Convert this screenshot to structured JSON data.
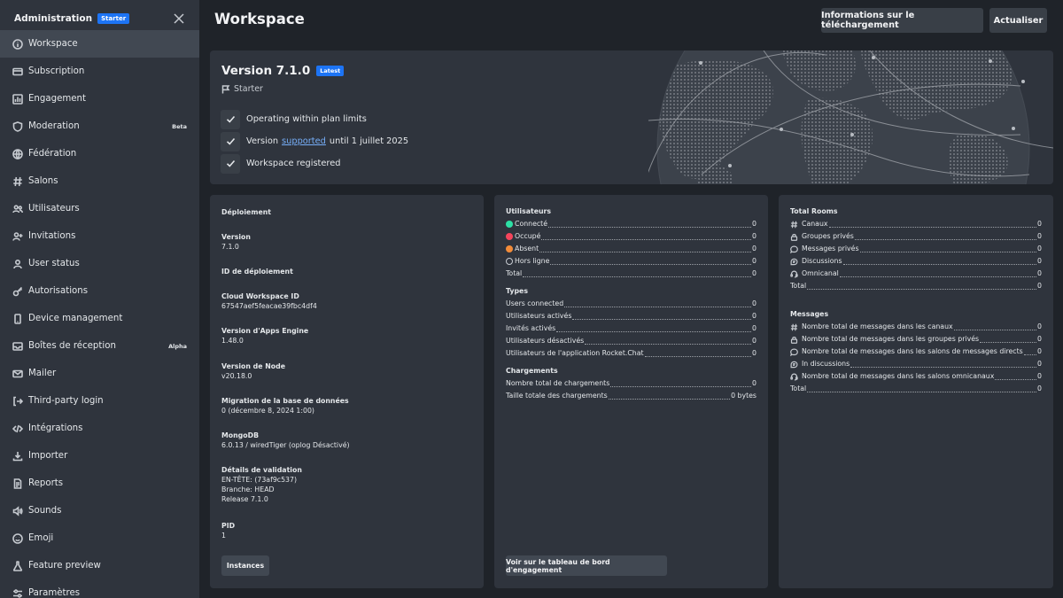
{
  "sidebar": {
    "title": "Administration",
    "badge": "Starter",
    "items": [
      {
        "label": "Workspace",
        "icon": "info-icon",
        "active": true
      },
      {
        "label": "Subscription",
        "icon": "card-icon"
      },
      {
        "label": "Engagement",
        "icon": "chart-icon"
      },
      {
        "label": "Moderation",
        "icon": "shield-icon",
        "tag": "Beta"
      },
      {
        "label": "Fédération",
        "icon": "globe-icon"
      },
      {
        "label": "Salons",
        "icon": "hashtag-icon"
      },
      {
        "label": "Utilisateurs",
        "icon": "team-icon"
      },
      {
        "label": "Invitations",
        "icon": "user-plus-icon"
      },
      {
        "label": "User status",
        "icon": "user-icon"
      },
      {
        "label": "Autorisations",
        "icon": "key-icon"
      },
      {
        "label": "Device management",
        "icon": "mobile-icon"
      },
      {
        "label": "Boîtes de réception",
        "icon": "mail-icon",
        "tag": "Alpha"
      },
      {
        "label": "Mailer",
        "icon": "envelope-icon"
      },
      {
        "label": "Third-party login",
        "icon": "login-icon"
      },
      {
        "label": "Intégrations",
        "icon": "code-icon"
      },
      {
        "label": "Importer",
        "icon": "import-icon"
      },
      {
        "label": "Reports",
        "icon": "document-icon"
      },
      {
        "label": "Sounds",
        "icon": "volume-icon"
      },
      {
        "label": "Emoji",
        "icon": "emoji-icon"
      },
      {
        "label": "Feature preview",
        "icon": "flask-icon"
      },
      {
        "label": "Paramètres",
        "icon": "settings-icon"
      }
    ]
  },
  "header": {
    "title": "Workspace",
    "download_info_label": "Informations sur le téléchargement",
    "refresh_label": "Actualiser"
  },
  "version_card": {
    "title": "Version 7.1.0",
    "badge": "Latest",
    "plan": "Starter",
    "checks": [
      {
        "text": "Operating within plan limits"
      },
      {
        "pre": "Version",
        "link": "supported",
        "post": "until 1 juillet 2025"
      },
      {
        "text": "Workspace registered"
      }
    ]
  },
  "deployment": {
    "heading": "Déploiement",
    "fields": [
      {
        "label": "Version",
        "value": "7.1.0"
      },
      {
        "label": "ID de déploiement",
        "value": ""
      },
      {
        "label": "Cloud Workspace ID",
        "value": "67547aef5feacae39fbc4df4"
      },
      {
        "label": "Version d'Apps Engine",
        "value": "1.48.0"
      },
      {
        "label": "Version de Node",
        "value": "v20.18.0"
      },
      {
        "label": "Migration de la base de données",
        "value": "0 (décembre 8, 2024 1:00)"
      },
      {
        "label": "MongoDB",
        "value": "6.0.13 / wiredTiger (oplog Désactivé)"
      },
      {
        "label": "Détails de validation",
        "value": "EN-TÊTE: (73af9c537)",
        "value2": "Branche: HEAD",
        "value3": "Release 7.1.0"
      },
      {
        "label": "PID",
        "value": "1"
      }
    ],
    "button": "Instances"
  },
  "users": {
    "heading": "Utilisateurs",
    "rows": [
      {
        "label": "Connecté",
        "value": "0",
        "status": "online"
      },
      {
        "label": "Occupé",
        "value": "0",
        "status": "busy"
      },
      {
        "label": "Absent",
        "value": "0",
        "status": "away"
      },
      {
        "label": "Hors ligne",
        "value": "0",
        "status": "offline"
      },
      {
        "label": "Total",
        "value": "0"
      }
    ],
    "types_heading": "Types",
    "types": [
      {
        "label": "Users connected",
        "value": "0"
      },
      {
        "label": "Utilisateurs activés",
        "value": "0"
      },
      {
        "label": "Invités activés",
        "value": "0"
      },
      {
        "label": "Utilisateurs désactivés",
        "value": "0"
      },
      {
        "label": "Utilisateurs de l'application Rocket.Chat",
        "value": "0"
      }
    ],
    "uploads_heading": "Chargements",
    "uploads": [
      {
        "label": "Nombre total de chargements",
        "value": "0"
      },
      {
        "label": "Taille totale des chargements",
        "value": "0 bytes"
      }
    ],
    "button": "Voir sur le tableau de bord d'engagement"
  },
  "rooms": {
    "heading": "Total Rooms",
    "rows": [
      {
        "label": "Canaux",
        "value": "0",
        "icon": "hashtag-icon"
      },
      {
        "label": "Groupes privés",
        "value": "0",
        "icon": "lock-icon"
      },
      {
        "label": "Messages privés",
        "value": "0",
        "icon": "chat-icon"
      },
      {
        "label": "Discussions",
        "value": "0",
        "icon": "discussion-icon"
      },
      {
        "label": "Omnicanal",
        "value": "0",
        "icon": "headset-icon"
      },
      {
        "label": "Total",
        "value": "0"
      }
    ],
    "messages_heading": "Messages",
    "messages": [
      {
        "label": "Nombre total de messages dans les canaux",
        "value": "0",
        "icon": "hashtag-icon"
      },
      {
        "label": "Nombre total de messages dans les groupes privés",
        "value": "0",
        "icon": "lock-icon"
      },
      {
        "label": "Nombre total de messages dans les salons de messages directs",
        "value": "0",
        "icon": "chat-icon"
      },
      {
        "label": "In discussions",
        "value": "0",
        "icon": "discussion-icon"
      },
      {
        "label": "Nombre total de messages dans les salons omnicanaux",
        "value": "0",
        "icon": "headset-icon"
      },
      {
        "label": "Total",
        "value": "0"
      }
    ]
  },
  "colors": {
    "online": "#2de0a5",
    "busy": "#f5455c",
    "away": "#f38c39",
    "accent": "#1d74f5",
    "link": "#76aef8"
  }
}
